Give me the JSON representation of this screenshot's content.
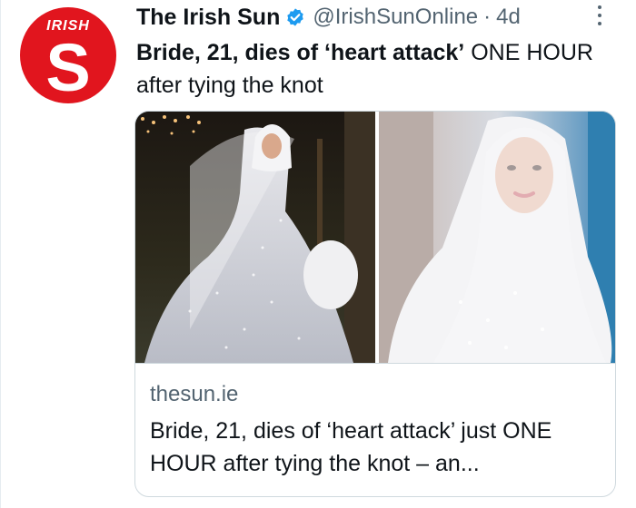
{
  "account": {
    "name": "The Irish Sun",
    "handle": "@IrishSunOnline",
    "separator": "·",
    "time": "4d",
    "avatar_label": "IRISH",
    "avatar_letter": "S",
    "brand_color": "#e1151e",
    "verified_color": "#1d9bf0"
  },
  "tweet": {
    "text_bold": "Bride, 21, dies of ‘heart attack’",
    "text_rest": " ONE HOUR after tying the knot"
  },
  "card": {
    "domain": "thesun.ie",
    "title": "Bride, 21, dies of ‘heart attack’ just ONE HOUR after tying the knot – an..."
  },
  "icons": {
    "verified": "verified-badge-icon",
    "more": "more-options-icon"
  }
}
